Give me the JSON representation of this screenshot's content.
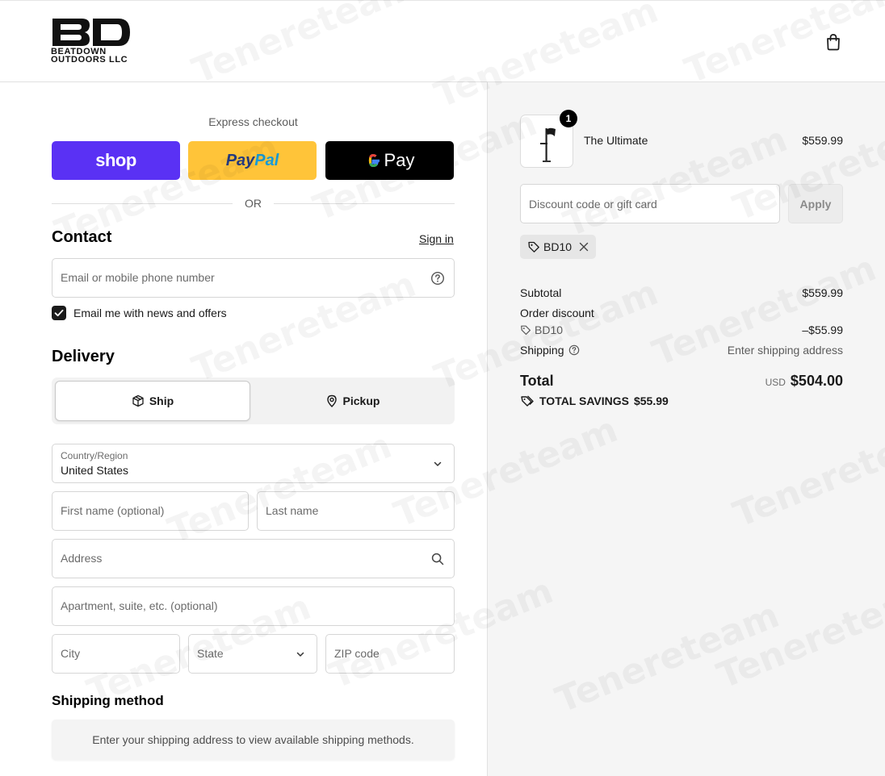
{
  "header": {
    "logo_main": "BD",
    "logo_line1": "BEATDOWN",
    "logo_line2": "OUTDOORS LLC",
    "cart_icon": "shopping-bag-icon"
  },
  "express": {
    "title": "Express checkout",
    "shop_label": "shop",
    "paypal_a": "Pay",
    "paypal_b": "Pal",
    "gpay_g": "G",
    "gpay_label": "Pay",
    "or_label": "OR"
  },
  "contact": {
    "heading": "Contact",
    "sign_in": "Sign in",
    "email_placeholder": "Email or mobile phone number",
    "newsletter_label": "Email me with news and offers",
    "newsletter_checked": true
  },
  "delivery": {
    "heading": "Delivery",
    "ship_label": "Ship",
    "pickup_label": "Pickup",
    "selected": "Ship",
    "country_label": "Country/Region",
    "country_value": "United States",
    "first_name_placeholder": "First name (optional)",
    "last_name_placeholder": "Last name",
    "address_placeholder": "Address",
    "apartment_placeholder": "Apartment, suite, etc. (optional)",
    "city_placeholder": "City",
    "state_placeholder": "State",
    "zip_placeholder": "ZIP code"
  },
  "shipping_method": {
    "heading": "Shipping method",
    "note": "Enter your shipping address to view available shipping methods."
  },
  "summary": {
    "item": {
      "name": "The Ultimate",
      "price": "$559.99",
      "quantity": "1"
    },
    "discount_placeholder": "Discount code or gift card",
    "apply_label": "Apply",
    "applied_code": "BD10",
    "subtotal_label": "Subtotal",
    "subtotal_value": "$559.99",
    "order_discount_label": "Order discount",
    "order_discount_code": "BD10",
    "order_discount_value": "–$55.99",
    "shipping_label": "Shipping",
    "shipping_value": "Enter shipping address",
    "total_label": "Total",
    "total_currency": "USD",
    "total_value": "$504.00",
    "savings_label": "TOTAL SAVINGS",
    "savings_value": "$55.99"
  },
  "watermark": "Tenereteam",
  "colors": {
    "shop": "#5a31f4",
    "paypal": "#ffc439",
    "gpay": "#000000",
    "summary_bg": "#f5f5f5"
  }
}
